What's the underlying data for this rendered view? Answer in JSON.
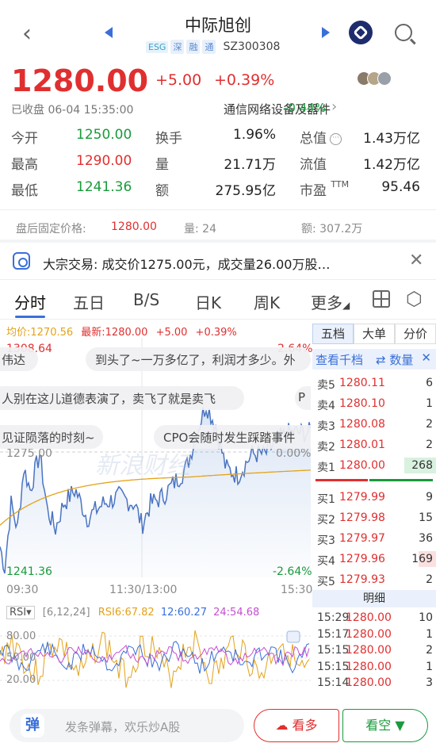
{
  "nav": {
    "back_icon": "chevron-left-icon",
    "title": "中际旭创",
    "tags": [
      "ESG",
      "深",
      "融",
      "通"
    ],
    "code": "SZ300308"
  },
  "quote": {
    "price": "1280.00",
    "change": "+5.00",
    "change_pct": "+0.39%",
    "status": "已收盘 06-04 15:35:00",
    "industry": "通信网络设备及器件",
    "industry_chg": "-0.44%",
    "rows": [
      {
        "l1": "今开",
        "v1": "1250.00",
        "l2": "换手",
        "v2": "1.96%",
        "l3": "总值",
        "v3": "1.43万亿"
      },
      {
        "l1": "最高",
        "v1": "1290.00",
        "l2": "量",
        "v2": "21.71万",
        "l3": "流值",
        "v3": "1.42万亿"
      },
      {
        "l1": "最低",
        "v1": "1241.36",
        "l2": "额",
        "v2": "275.95亿",
        "l3": "市盈",
        "l3_sup": "TTM",
        "v3": "95.46"
      }
    ]
  },
  "after_hours": {
    "label": "盘后固定价格:",
    "price": "1280.00",
    "vol": "量: 24",
    "amt": "额: 307.2万"
  },
  "banner": {
    "text": "大宗交易: 成交价1275.00元，成交量26.00万股…"
  },
  "tabs": [
    "分时",
    "五日",
    "B/S",
    "日K",
    "周K",
    "更多"
  ],
  "chart": {
    "legend_avg": "均价:1270.56",
    "legend_last": "最新:1280.00",
    "legend_chg": "+5.00",
    "legend_pct": "+0.39%",
    "y_high": "1308.64",
    "y_mid": "1275.00",
    "y_low": "1241.36",
    "pct_high": "2.64%",
    "pct_mid": "0.00%",
    "pct_low": "-2.64%",
    "x_labels": [
      "09:30",
      "11:30/13:00",
      "15:30"
    ],
    "watermark": "新浪财经"
  },
  "danmu": [
    "伟达",
    "到头了~一万多亿了，利润才多少。外",
    "人别在这儿道德表演了，卖飞了就是卖飞",
    "P",
    "见证陨落的时刻~",
    "CPO会随时发生踩踏事件"
  ],
  "orderbook": {
    "tabs": [
      "五档",
      "大单",
      "分价"
    ],
    "sub_left": "查看千档",
    "sub_mid": "⇄ 数量",
    "asks": [
      {
        "label": "卖5",
        "price": "1280.11",
        "vol": "6"
      },
      {
        "label": "卖4",
        "price": "1280.10",
        "vol": "1"
      },
      {
        "label": "卖3",
        "price": "1280.08",
        "vol": "2"
      },
      {
        "label": "卖2",
        "price": "1280.01",
        "vol": "2"
      },
      {
        "label": "卖1",
        "price": "1280.00",
        "vol": "268"
      }
    ],
    "bids": [
      {
        "label": "买1",
        "price": "1279.99",
        "vol": "9"
      },
      {
        "label": "买2",
        "price": "1279.98",
        "vol": "15"
      },
      {
        "label": "买3",
        "price": "1279.97",
        "vol": "36"
      },
      {
        "label": "买4",
        "price": "1279.96",
        "vol": "169"
      },
      {
        "label": "买5",
        "price": "1279.93",
        "vol": "2"
      }
    ],
    "detail_title": "明细",
    "details": [
      {
        "time": "15:29",
        "price": "1280.00",
        "vol": "10"
      },
      {
        "time": "15:17",
        "price": "1280.00",
        "vol": "1"
      },
      {
        "time": "15:15",
        "price": "1280.00",
        "vol": "2"
      },
      {
        "time": "15:15",
        "price": "1280.00",
        "vol": "1"
      },
      {
        "time": "15:14",
        "price": "1280.00",
        "vol": "3"
      }
    ]
  },
  "rsi": {
    "name": "RSI▾",
    "params": "[6,12,24]",
    "r6": "RSI6:67.82",
    "r12": "12:60.27",
    "r24": "24:54.68",
    "y80": "80.00",
    "y50": "50.00",
    "y20": "20.00"
  },
  "bottom": {
    "logo": "弹",
    "placeholder": "发条弹幕，欢乐炒A股",
    "bull": "看多",
    "bear": "看空"
  },
  "colors": {
    "up": "#e02f2f",
    "down": "#1a9a3c",
    "accent": "#3a6fd8"
  }
}
